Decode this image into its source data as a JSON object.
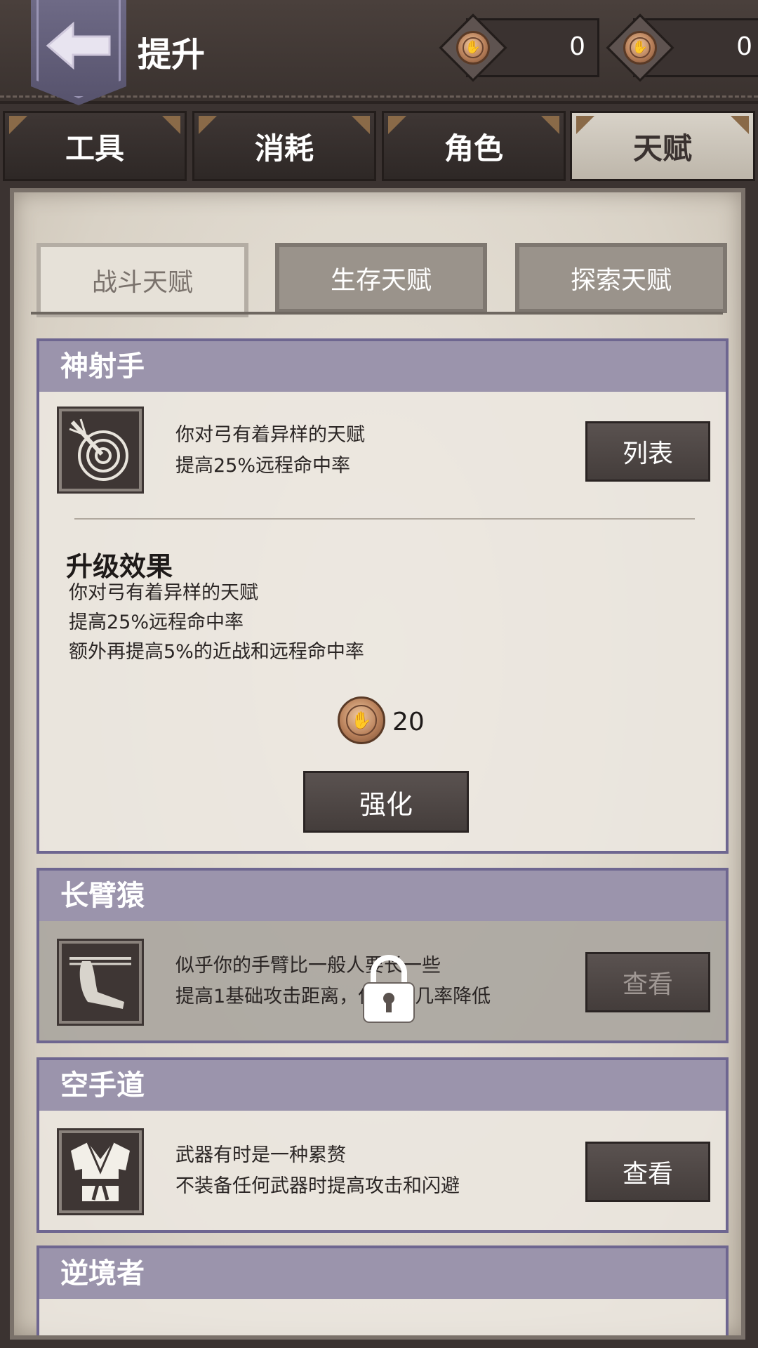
{
  "header": {
    "title": "提升",
    "currencies": [
      {
        "icon": "talent-coin-icon",
        "value": "0"
      },
      {
        "icon": "talent-coin-icon",
        "value": "0"
      }
    ]
  },
  "main_tabs": [
    {
      "label": "工具",
      "active": false
    },
    {
      "label": "消耗",
      "active": false
    },
    {
      "label": "角色",
      "active": false
    },
    {
      "label": "天赋",
      "active": true
    }
  ],
  "sub_tabs": [
    {
      "label": "战斗天赋",
      "active": true
    },
    {
      "label": "生存天赋",
      "active": false
    },
    {
      "label": "探索天赋",
      "active": false
    }
  ],
  "talents": [
    {
      "name": "神射手",
      "icon": "archery-target-icon",
      "desc": [
        "你对弓有着异样的天赋",
        "提高25%远程命中率"
      ],
      "button": "列表",
      "expanded": true,
      "upgrade": {
        "title": "升级效果",
        "lines": [
          "你对弓有着异样的天赋",
          "提高25%远程命中率",
          "额外再提高5%的近战和远程命中率"
        ],
        "cost": "20",
        "button": "强化"
      }
    },
    {
      "name": "长臂猿",
      "icon": "gibbon-arm-icon",
      "desc": [
        "似乎你的手臂比一般人要长一些",
        "提高1基础攻击距离，但闪避几率降低"
      ],
      "button": "查看",
      "locked": true
    },
    {
      "name": "空手道",
      "icon": "karate-gi-icon",
      "desc": [
        "武器有时是一种累赘",
        "不装备任何武器时提高攻击和闪避"
      ],
      "button": "查看"
    },
    {
      "name": "逆境者",
      "partial": true
    }
  ]
}
